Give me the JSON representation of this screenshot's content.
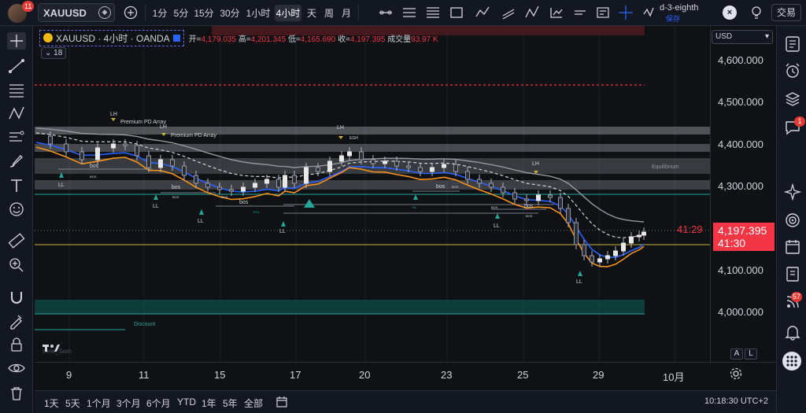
{
  "topbar": {
    "notification_count": "11",
    "symbol": "XAUUSD",
    "timeframes": [
      "1分",
      "5分",
      "15分",
      "30分",
      "1小时",
      "4小时",
      "天",
      "周",
      "月"
    ],
    "active_timeframe": "4小时",
    "layout_name": "d-3-eighth",
    "layout_saved": "保存",
    "trade_label": "交易"
  },
  "legend": {
    "title": "XAUUSD · 4小时 · OANDA",
    "open_label": "开=",
    "open": "4,179.035",
    "high_label": "高=",
    "high": "4,201.345",
    "low_label": "低=",
    "low": "4,165.690",
    "close_label": "收=",
    "close": "4,197.395",
    "volume_label": "成交量",
    "volume": "93.97 K",
    "indicator_count": "18"
  },
  "price_axis": {
    "currency": "USD",
    "labels": [
      "4,600.000",
      "4,500.000",
      "4,400.000",
      "4,300.000",
      "4,100.000",
      "4,000.000"
    ],
    "current_price": "4,197.395",
    "countdown": "41:30",
    "countdown_left": "41:29",
    "auto_label": "A",
    "log_label": "L"
  },
  "time_axis": {
    "labels": [
      "9",
      "11",
      "15",
      "17",
      "20",
      "23",
      "25",
      "29",
      "10月"
    ]
  },
  "bottombar": {
    "ranges": [
      "1天",
      "5天",
      "1个月",
      "3个月",
      "6个月",
      "YTD",
      "1年",
      "5年",
      "全部"
    ],
    "clock": "10:18:30 UTC+2"
  },
  "annotations": {
    "premium_pd_array_1": "Premium PD Array",
    "premium_pd_array_2": "Premium PD Array",
    "equilibrium": "Equilibrium",
    "discount": "Discount",
    "lh": "LH",
    "ll": "LL",
    "hl": "HL",
    "bos": "bos",
    "bos_upper": "BOS",
    "egh": "EGH",
    "egl": "EGL",
    "watermark": "view_Sam"
  },
  "rightbar": {
    "chat_badge": "1",
    "alerts_badge": "57"
  },
  "colors": {
    "bearish": "#f23645",
    "ema_fast": "#2962ff",
    "ema_mid": "#f7931a",
    "ema_slow": "#9598a1",
    "level_green": "#26a69a",
    "level_yellow": "#c8b432"
  }
}
